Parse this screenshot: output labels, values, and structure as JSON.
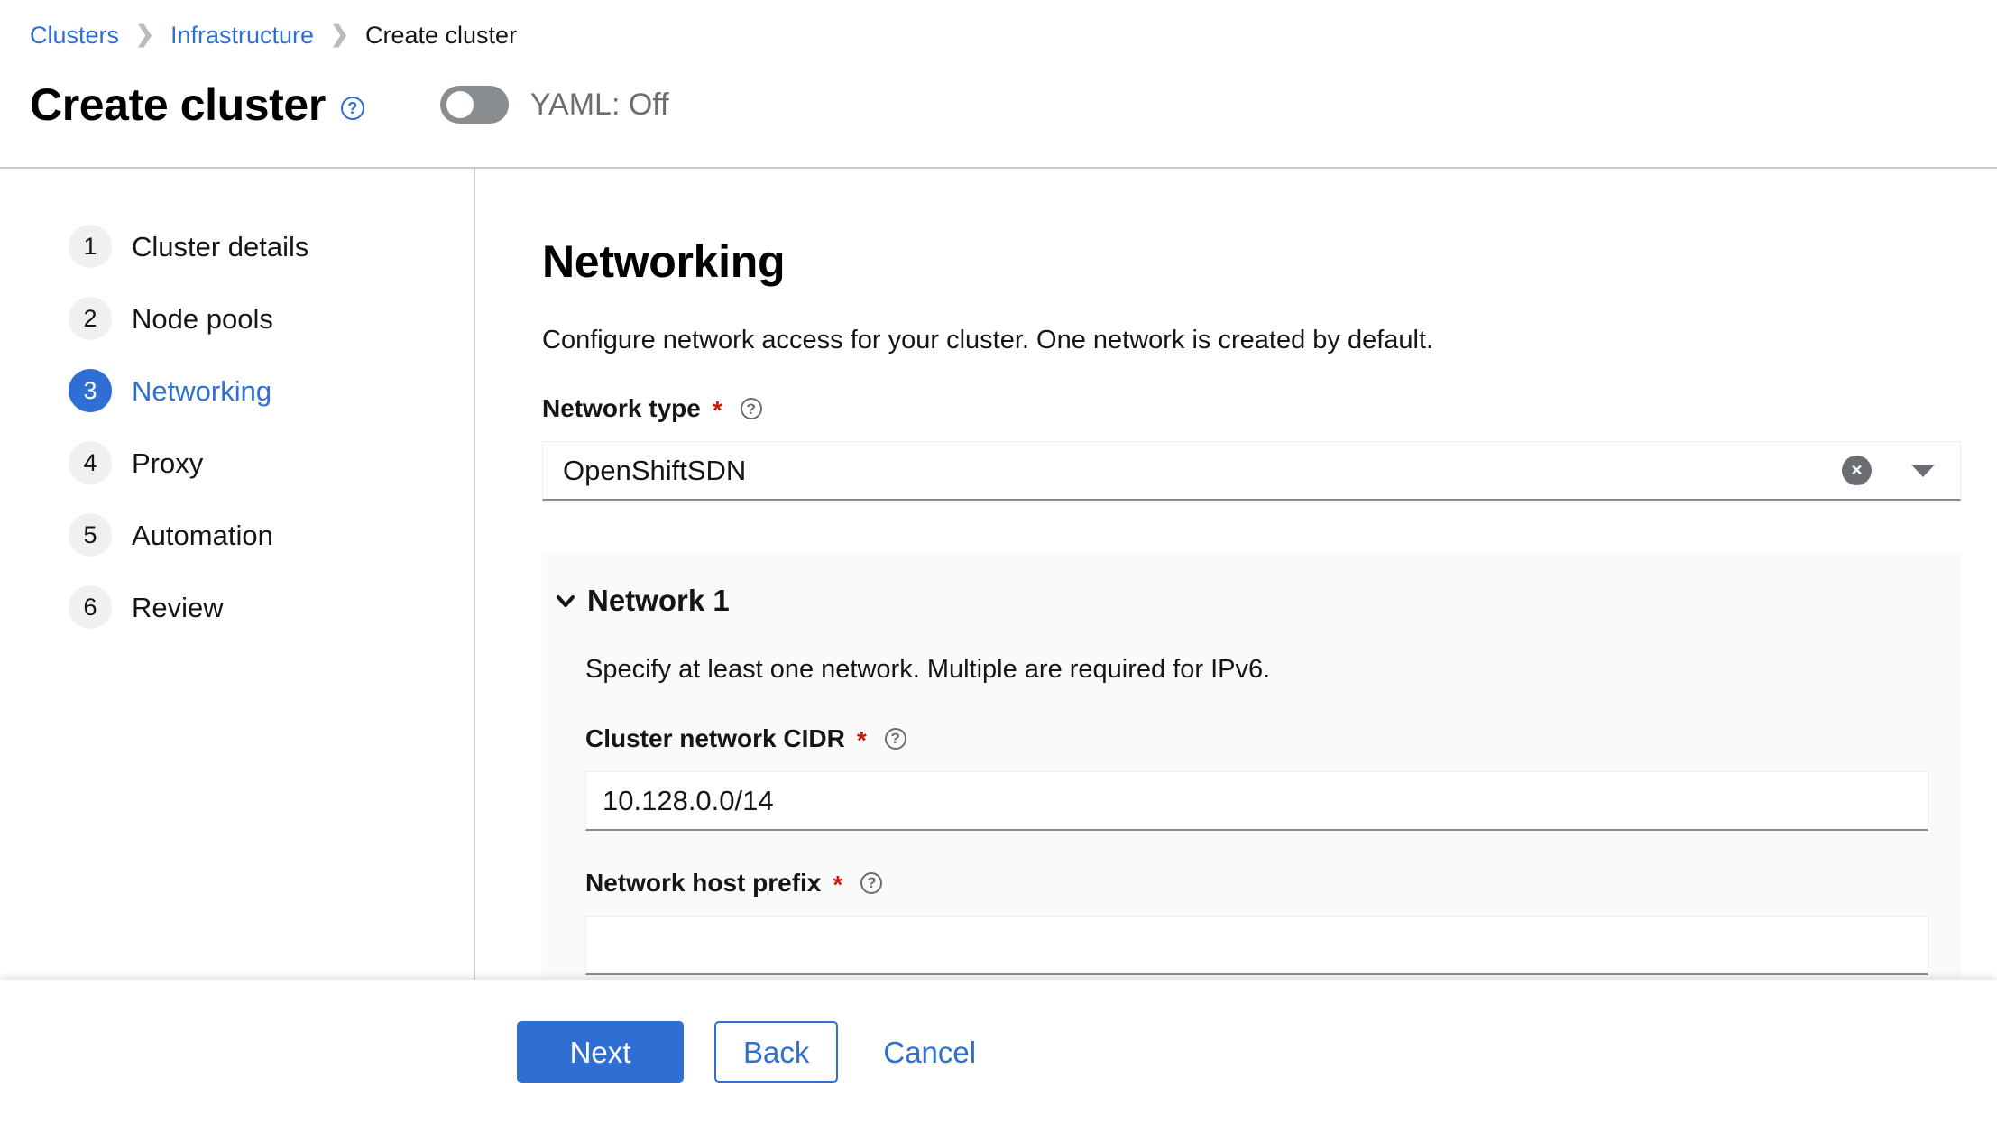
{
  "breadcrumb": {
    "items": [
      {
        "label": "Clusters",
        "type": "link"
      },
      {
        "label": "Infrastructure",
        "type": "link"
      },
      {
        "label": "Create cluster",
        "type": "current"
      }
    ],
    "separator": "❯"
  },
  "header": {
    "title": "Create cluster",
    "help_icon": "question-circle-icon",
    "help_glyph": "?",
    "yaml_toggle": {
      "label": "YAML: Off",
      "state": "off",
      "icon": "toggle-switch"
    }
  },
  "wizard": {
    "steps": [
      {
        "number": "1",
        "label": "Cluster details",
        "active": false
      },
      {
        "number": "2",
        "label": "Node pools",
        "active": false
      },
      {
        "number": "3",
        "label": "Networking",
        "active": true
      },
      {
        "number": "4",
        "label": "Proxy",
        "active": false
      },
      {
        "number": "5",
        "label": "Automation",
        "active": false
      },
      {
        "number": "6",
        "label": "Review",
        "active": false
      }
    ]
  },
  "main": {
    "section_title": "Networking",
    "section_description": "Configure network access for your cluster. One network is created by default.",
    "network_type": {
      "label": "Network type",
      "required_marker": "*",
      "help_icon": "question-circle-icon",
      "help_glyph": "?",
      "value": "OpenShiftSDN",
      "clear_icon": "times-circle-icon",
      "clear_glyph": "×",
      "caret_icon": "caret-down-icon"
    },
    "network_panel": {
      "chevron_icon": "chevron-down-icon",
      "title": "Network 1",
      "description": "Specify at least one network. Multiple are required for IPv6.",
      "fields": [
        {
          "label": "Cluster network CIDR",
          "required_marker": "*",
          "help_icon": "question-circle-icon",
          "help_glyph": "?",
          "value": "10.128.0.0/14"
        },
        {
          "label": "Network host prefix",
          "required_marker": "*",
          "help_icon": "question-circle-icon",
          "help_glyph": "?",
          "value": ""
        }
      ]
    }
  },
  "footer": {
    "next_label": "Next",
    "back_label": "Back",
    "cancel_label": "Cancel"
  },
  "colors": {
    "accent_blue": "#2f6fd3",
    "required_red": "#c9190b",
    "panel_grey": "#fafafa",
    "muted_grey": "#6a6e73"
  }
}
